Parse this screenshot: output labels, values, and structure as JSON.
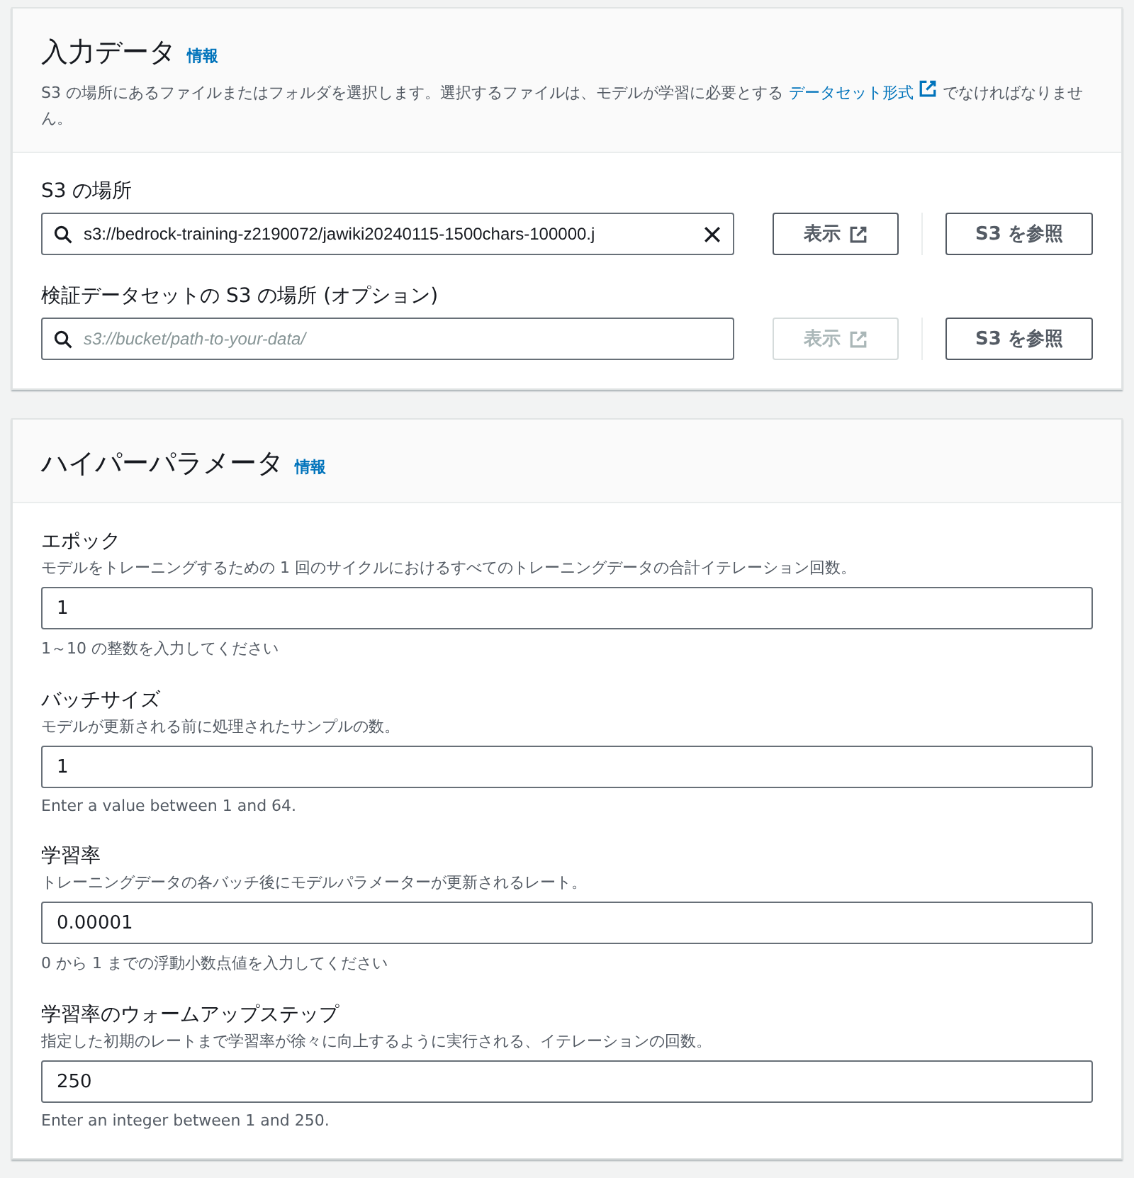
{
  "input_data": {
    "title": "入力データ",
    "info_link": "情報",
    "description": {
      "before": "S3 の場所にあるファイルまたはフォルダを選択します。選択するファイルは、モデルが学習に必要とする",
      "link": "データセット形式",
      "after": "でなければなりません。"
    },
    "fields": [
      {
        "label": "S3 の場所",
        "value": "s3://bedrock-training-z2190072/jawiki20240115-1500chars-100000.j",
        "clearable": true,
        "view_button": {
          "label": "表示",
          "disabled": false
        },
        "browse_button": "S3 を参照"
      },
      {
        "label": "検証データセットの S3 の場所 (オプション)",
        "placeholder": "s3://bucket/path-to-your-data/",
        "clearable": false,
        "view_button": {
          "label": "表示",
          "disabled": true
        },
        "browse_button": "S3 を参照"
      }
    ]
  },
  "hyperparameters": {
    "title": "ハイパーパラメータ",
    "info_link": "情報",
    "fields": [
      {
        "label": "エポック",
        "description": "モデルをトレーニングするための 1 回のサイクルにおけるすべてのトレーニングデータの合計イテレーション回数。",
        "value": "1",
        "constraint": "1～10 の整数を入力してください"
      },
      {
        "label": "バッチサイズ",
        "description": "モデルが更新される前に処理されたサンプルの数。",
        "value": "1",
        "constraint": "Enter a value between 1 and 64."
      },
      {
        "label": "学習率",
        "description": "トレーニングデータの各バッチ後にモデルパラメーターが更新されるレート。",
        "value": "0.00001",
        "constraint": "0 から 1 までの浮動小数点値を入力してください"
      },
      {
        "label": "学習率のウォームアップステップ",
        "description": "指定した初期のレートまで学習率が徐々に向上するように実行される、イテレーションの回数。",
        "value": "250",
        "constraint": "Enter an integer between 1 and 250."
      }
    ]
  }
}
